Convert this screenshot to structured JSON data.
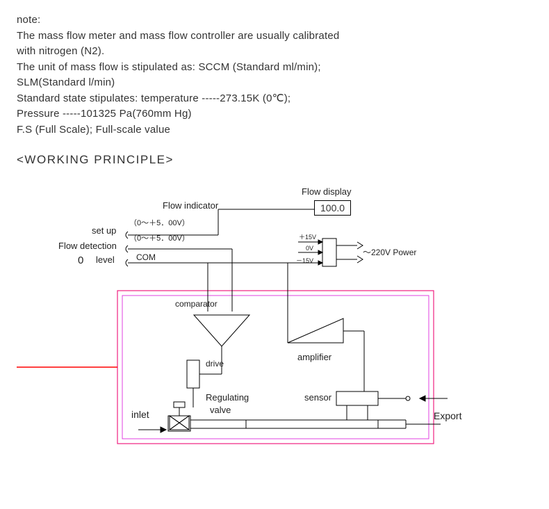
{
  "note": {
    "title": "note:",
    "l1": "The mass flow meter and mass flow controller are usually calibrated",
    "l2": "with nitrogen (N2).",
    "l3": "The unit of mass flow is stipulated as: SCCM (Standard ml/min);",
    "l4": "SLM(Standard l/min)",
    "l5": "Standard state stipulates: temperature -----273.15K (0℃);",
    "l6": " Pressure -----101325 Pa(760mm Hg)",
    "l7": "F.S (Full Scale); Full-scale value"
  },
  "heading": "<WORKING PRINCIPLE>",
  "diagram": {
    "flow_display_label": "Flow display",
    "flow_display_value": "100.0",
    "flow_indicator": "Flow indicator",
    "setup": "set up",
    "v_setup": "（0～＋5．00V）",
    "flow_detection": "Flow detection",
    "v_detect": "（0～＋5．00V）",
    "level": "level",
    "level_zero": "0",
    "com": "COM",
    "plus15": "＋15V",
    "zeroV": "0V",
    "minus15": "－15V",
    "power": "～220V Power",
    "comparator": "comparator",
    "drive": "drive",
    "amplifier": "amplifier",
    "regulating_valve": "Regulating",
    "valve": "valve",
    "sensor": "sensor",
    "inlet": "inlet",
    "export": "Export"
  }
}
